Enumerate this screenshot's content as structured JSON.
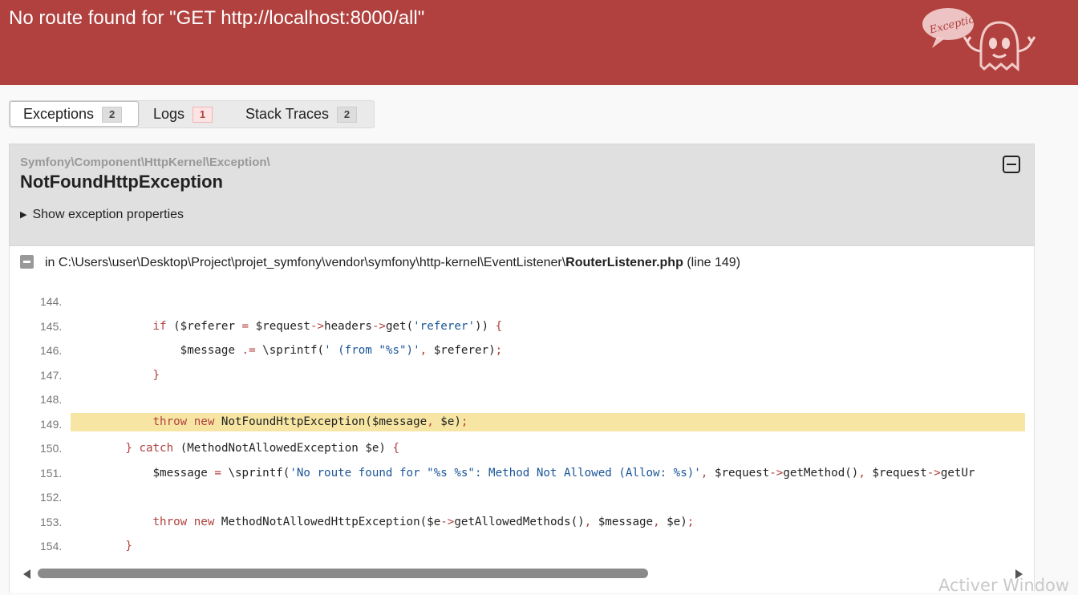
{
  "header": {
    "title": "No route found for \"GET http://localhost:8000/all\"",
    "logo_text": "Exception!",
    "color": "#b0413e"
  },
  "tabs": [
    {
      "label": "Exceptions",
      "count": "2",
      "active": true
    },
    {
      "label": "Logs",
      "count": "1",
      "status": "error"
    },
    {
      "label": "Stack Traces",
      "count": "2"
    }
  ],
  "exception": {
    "namespace": "Symfony\\Component\\HttpKernel\\Exception\\",
    "class": "NotFoundHttpException",
    "properties_label": "Show exception properties"
  },
  "trace": {
    "in_label": "in",
    "path": "C:\\Users\\user\\Desktop\\Project\\projet_symfony\\vendor\\symfony\\http-kernel\\EventListener\\",
    "file": "RouterListener.php",
    "line_info": "(line 149)",
    "highlight_line": 149,
    "lines": [
      {
        "num": "144.",
        "code": ""
      },
      {
        "num": "145.",
        "code": "            if ($referer = $request->headers->get('referer')) {"
      },
      {
        "num": "146.",
        "code": "                $message .= \\sprintf(' (from \"%s\")', $referer);"
      },
      {
        "num": "147.",
        "code": "            }"
      },
      {
        "num": "148.",
        "code": ""
      },
      {
        "num": "149.",
        "code": "            throw new NotFoundHttpException($message, $e);"
      },
      {
        "num": "150.",
        "code": "        } catch (MethodNotAllowedException $e) {"
      },
      {
        "num": "151.",
        "code": "            $message = \\sprintf('No route found for \"%s %s\": Method Not Allowed (Allow: %s)', $request->getMethod(), $request->getUr"
      },
      {
        "num": "152.",
        "code": ""
      },
      {
        "num": "153.",
        "code": "            throw new MethodNotAllowedHttpException($e->getAllowedMethods(), $message, $e);"
      },
      {
        "num": "154.",
        "code": "        }"
      }
    ]
  },
  "scrollbar": {
    "thumb_fraction": 0.63
  },
  "watermark": "Activer Window"
}
